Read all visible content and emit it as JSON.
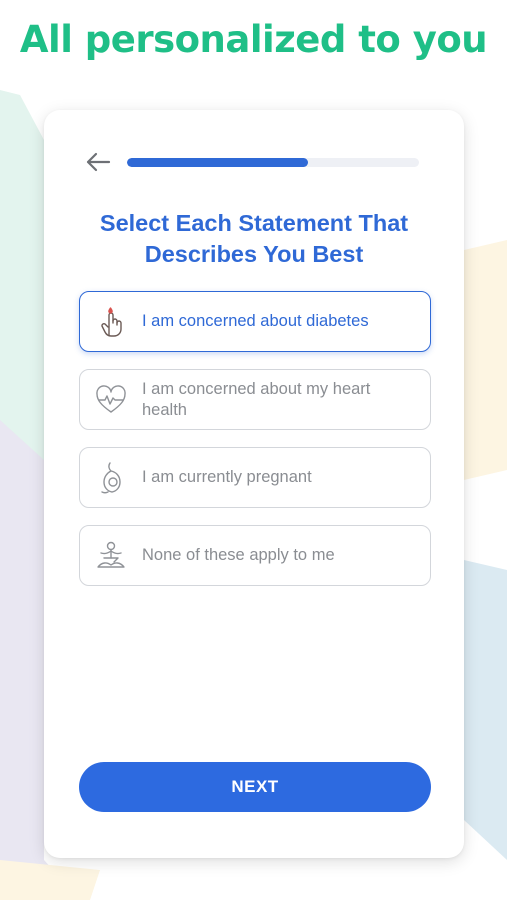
{
  "headline": "All personalized to you",
  "card": {
    "back_icon": "arrow-left-icon",
    "progress": 0.62,
    "title": "Select Each Statement That Describes You Best",
    "options": [
      {
        "label": "I am concerned about diabetes",
        "icon": "finger-prick-icon",
        "selected": true
      },
      {
        "label": "I am concerned about my heart health",
        "icon": "heart-pulse-icon",
        "selected": false
      },
      {
        "label": "I am currently pregnant",
        "icon": "pregnant-icon",
        "selected": false
      },
      {
        "label": "None of these apply to me",
        "icon": "meditation-icon",
        "selected": false
      }
    ],
    "next_label": "NEXT"
  },
  "colors": {
    "headline": "#1fbf87",
    "accent": "#2f69d6",
    "button": "#2d6ae0",
    "progress_track": "#eef0f5",
    "background_shapes": [
      "#e3f4ee",
      "#e9e7f2",
      "#fdf5e2",
      "#dbeaf2"
    ]
  }
}
